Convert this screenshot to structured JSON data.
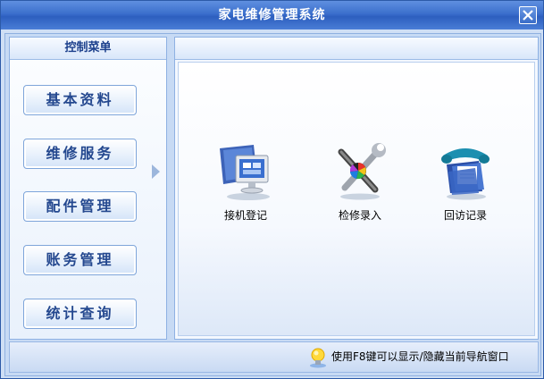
{
  "window": {
    "title": "家电维修管理系统"
  },
  "left_panel": {
    "header": "控制菜单",
    "items": [
      {
        "label": "基本资料"
      },
      {
        "label": "维修服务",
        "active": true
      },
      {
        "label": "配件管理"
      },
      {
        "label": "账务管理"
      },
      {
        "label": "统计查询"
      }
    ]
  },
  "main": {
    "functions": [
      {
        "label": "接机登记",
        "icon": "monitor-icon"
      },
      {
        "label": "检修录入",
        "icon": "tools-icon"
      },
      {
        "label": "回访记录",
        "icon": "phone-folder-icon"
      }
    ]
  },
  "status": {
    "hint": "使用F8键可以显示/隐藏当前导航窗口"
  },
  "colors": {
    "title_bar": "#3b6fcc",
    "nav_text": "#24488f",
    "panel_border": "#8eb1e3"
  }
}
